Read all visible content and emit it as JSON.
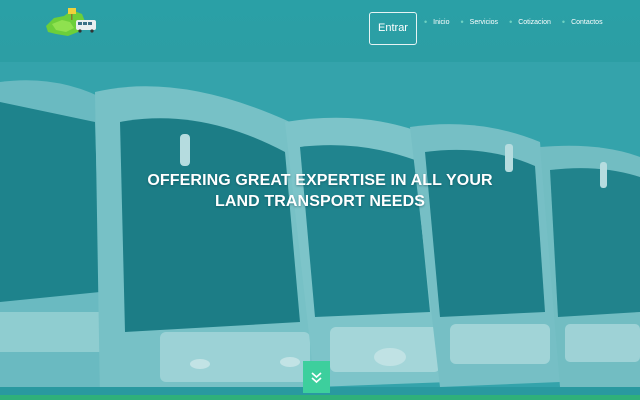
{
  "header": {
    "logo_icon": "bus-map-logo-icon",
    "login_button": "Entrar",
    "nav": [
      {
        "label": "Inicio"
      },
      {
        "label": "Servicios"
      },
      {
        "label": "Cotizacion"
      },
      {
        "label": "Contactos"
      }
    ]
  },
  "hero": {
    "title_line1": "OFFERING GREAT EXPERTISE IN ALL YOUR",
    "title_line2": "LAND TRANSPORT NEEDS",
    "background_image": "row-of-coach-buses",
    "scroll_icon": "chevron-double-down-icon"
  },
  "colors": {
    "header_bg": "#2aa0a6",
    "hero_tint": "#2f9ea6",
    "accent_green": "#3dcf9d",
    "nav_dot": "#6fd2c2"
  }
}
